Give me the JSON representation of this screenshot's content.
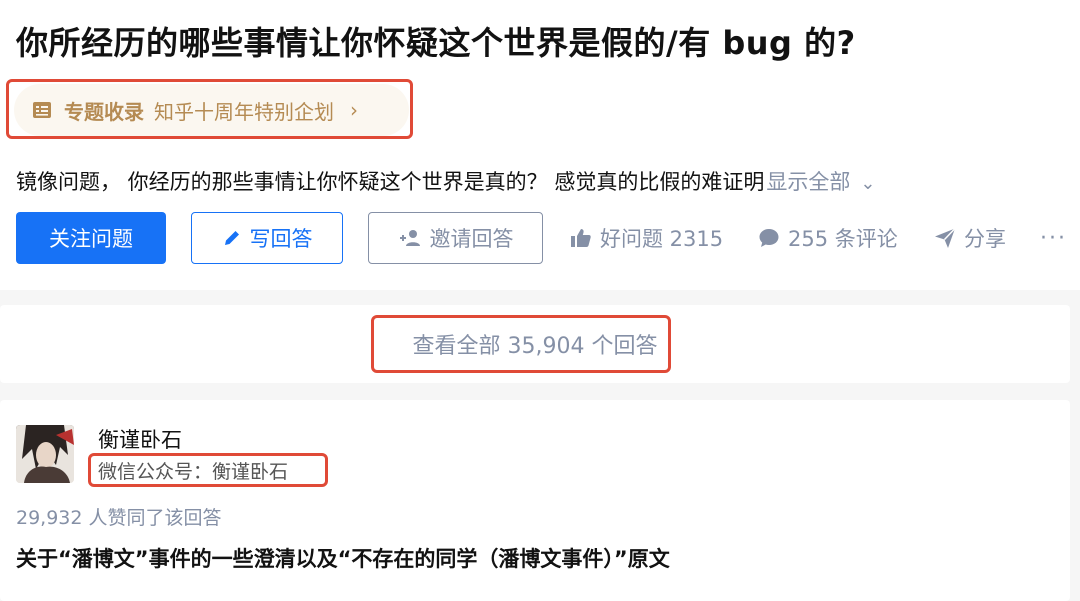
{
  "question": {
    "title": "你所经历的哪些事情让你怀疑这个世界是假的/有 bug 的?",
    "topic_tag": {
      "icon": "topic-list-icon",
      "category": "专题收录",
      "name": "知乎十周年特别企划",
      "chevron": "›"
    },
    "excerpt": "镜像问题， 你经历的那些事情让你怀疑这个世界是真的？ 感觉真的比假的难证明",
    "show_all_label": "显示全部",
    "show_all_chevron": "⌄"
  },
  "actions": {
    "follow_label": "关注问题",
    "write_label": "写回答",
    "invite_label": "邀请回答",
    "good_question_label": "好问题 2315",
    "comments_label": "255 条评论",
    "share_label": "分享",
    "more_label": "···"
  },
  "answers_summary": {
    "label": "查看全部 35,904 个回答"
  },
  "answer": {
    "author_name": "衡谨卧石",
    "author_bio": "微信公众号：衡谨卧石",
    "vote_text": "29,932 人赞同了该回答",
    "title": "关于“潘博文”事件的一些澄清以及“不存在的同学（潘博文事件）”原文"
  },
  "colors": {
    "brand_blue": "#1772f6",
    "muted_gray": "#8590a6",
    "tag_gold": "#b58b53",
    "highlight_red": "#e04a37"
  }
}
